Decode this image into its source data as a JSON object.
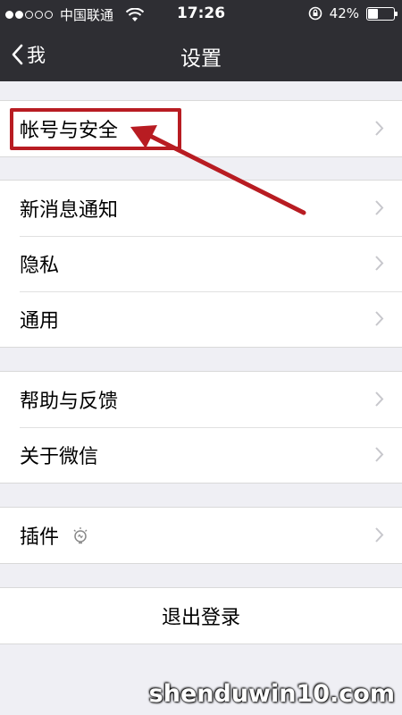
{
  "status_bar": {
    "carrier": "中国联通",
    "time": "17:26",
    "battery": "42%",
    "battery_level": 0.42
  },
  "navbar": {
    "back_label": "我",
    "title": "设置"
  },
  "groups": [
    {
      "items": [
        {
          "label": "帐号与安全"
        }
      ]
    },
    {
      "items": [
        {
          "label": "新消息通知"
        },
        {
          "label": "隐私"
        },
        {
          "label": "通用"
        }
      ]
    },
    {
      "items": [
        {
          "label": "帮助与反馈"
        },
        {
          "label": "关于微信"
        }
      ]
    },
    {
      "items": [
        {
          "label": "插件"
        }
      ]
    }
  ],
  "logout": {
    "label": "退出登录"
  },
  "watermark": "shenduwin10.com",
  "colors": {
    "navbar_bg": "#2e2e33",
    "page_bg": "#efeff4",
    "annotation_red": "#b81c22"
  }
}
